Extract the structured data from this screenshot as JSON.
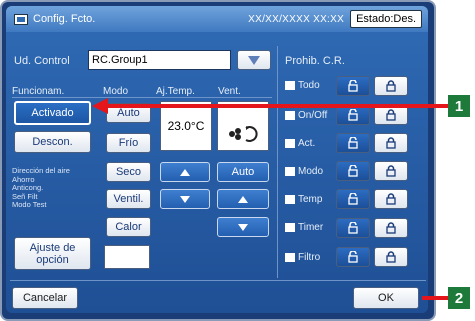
{
  "window": {
    "title": "Config. Fcto.",
    "datetime": "XX/XX/XXXX  XX:XX",
    "estado": "Estado:Des."
  },
  "ud_control": {
    "label": "Ud. Control",
    "value": "RC.Group1"
  },
  "funcionam": {
    "label": "Funcionam.",
    "activado": "Activado",
    "descon": "Descon."
  },
  "modo": {
    "label": "Modo",
    "items": [
      "Auto",
      "Frío",
      "Seco",
      "Ventil.",
      "Calor"
    ]
  },
  "ajtemp": {
    "label": "Aj.Temp.",
    "value": "23.0°C"
  },
  "vent": {
    "label": "Vent.",
    "auto": "Auto"
  },
  "info_list": [
    "Dirección del aire",
    "Ahorro",
    "Anticong.",
    "Señ Filt",
    "Modo Test"
  ],
  "ajuste": "Ajuste de opción",
  "prohib": {
    "label": "Prohib. C.R.",
    "rows": [
      {
        "label": "Todo"
      },
      {
        "label": "On/Off"
      },
      {
        "label": "Act."
      },
      {
        "label": "Modo"
      },
      {
        "label": "Temp"
      },
      {
        "label": "Timer"
      },
      {
        "label": "Filtro"
      }
    ]
  },
  "footer": {
    "cancel": "Cancelar",
    "ok": "OK"
  },
  "callouts": {
    "one": "1",
    "two": "2"
  },
  "colors": {
    "callout": "#1e7a3a",
    "arrow": "#e4161b"
  }
}
